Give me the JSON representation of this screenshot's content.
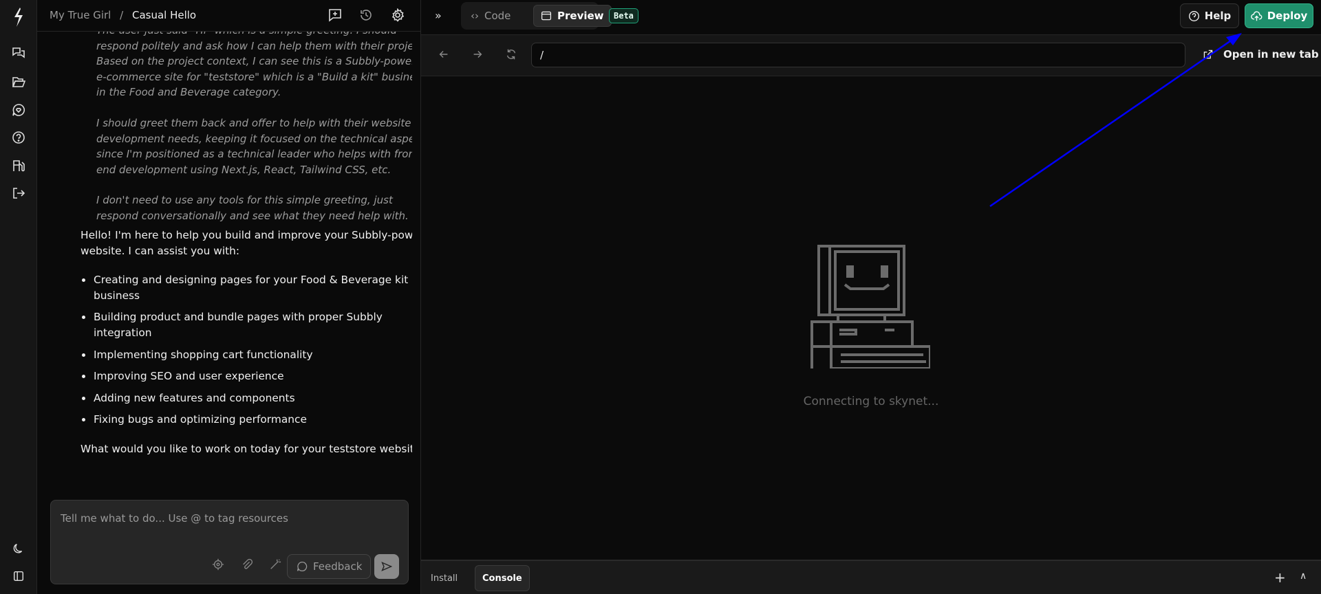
{
  "header": {
    "project": "My True Girl",
    "separator": "/",
    "chat_title": "Casual Hello"
  },
  "reasoning": [
    "The user just said \"Hi\" which is a simple greeting. I should respond politely and ask how I can help them with their project. Based on the project context, I can see this is a Subbly-powered e-commerce site for \"teststore\" which is a \"Build a kit\" business in the Food and Beverage category.",
    "I should greet them back and offer to help with their website development needs, keeping it focused on the technical aspects since I'm positioned as a technical leader who helps with front-end development using Next.js, React, Tailwind CSS, etc.",
    "I don't need to use any tools for this simple greeting, just respond conversationally and see what they need help with."
  ],
  "answer": {
    "intro": "Hello! I'm here to help you build and improve your Subbly-powered website. I can assist you with:",
    "items": [
      "Creating and designing pages for your Food & Beverage kit business",
      "Building product and bundle pages with proper Subbly integration",
      "Implementing shopping cart functionality",
      "Improving SEO and user experience",
      "Adding new features and components",
      "Fixing bugs and optimizing performance"
    ],
    "outro": "What would you like to work on today for your teststore website?"
  },
  "input": {
    "placeholder": "Tell me what to do... Use @ to tag resources",
    "feedback_label": "Feedback"
  },
  "toolbar": {
    "code": "Code",
    "preview": "Preview",
    "beta": "Beta",
    "help": "Help",
    "deploy": "Deploy"
  },
  "preview": {
    "url": "/",
    "open_new_tab": "Open in new tab",
    "status": "Connecting to skynet..."
  },
  "bottom_tabs": {
    "install": "Install",
    "console": "Console"
  },
  "colors": {
    "accent": "#1f8f6c",
    "annotation_arrow": "#0000ff"
  }
}
